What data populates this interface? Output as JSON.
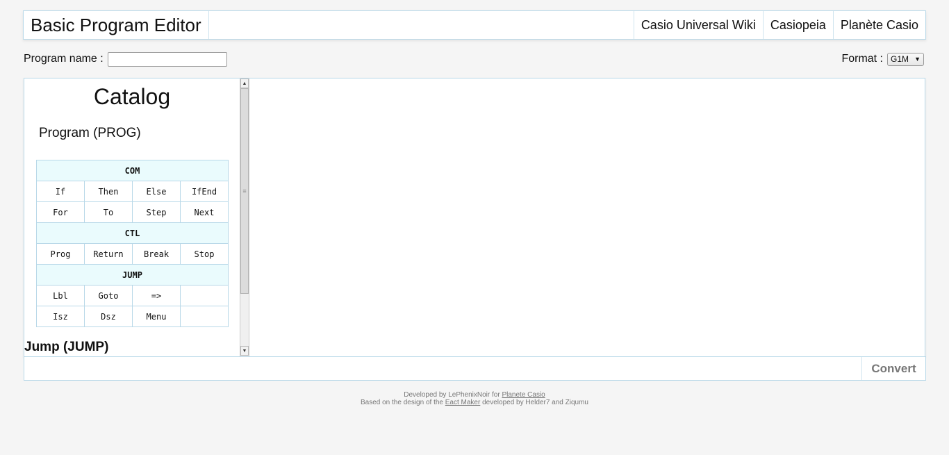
{
  "header": {
    "title": "Basic Program Editor",
    "links": [
      "Casio Universal Wiki",
      "Casiopeia",
      "Planète Casio"
    ]
  },
  "toolbar": {
    "program_name_label": "Program name :",
    "program_name_value": "",
    "format_label": "Format :",
    "format_value": "G1M"
  },
  "catalog": {
    "title": "Catalog",
    "section": "Program (PROG)",
    "groups": [
      {
        "name": "COM",
        "rows": [
          [
            "If",
            "Then",
            "Else",
            "IfEnd"
          ],
          [
            "For",
            "To",
            "Step",
            "Next"
          ]
        ]
      },
      {
        "name": "CTL",
        "rows": [
          [
            "Prog",
            "Return",
            "Break",
            "Stop"
          ]
        ]
      },
      {
        "name": "JUMP",
        "rows": [
          [
            "Lbl",
            "Goto",
            "=>",
            ""
          ],
          [
            "Isz",
            "Dsz",
            "Menu",
            ""
          ]
        ]
      }
    ],
    "next_section": "Jump (JUMP)"
  },
  "actions": {
    "convert_label": "Convert"
  },
  "footer": {
    "line1_prefix": "Developed by LePhenixNoir for",
    "line1_link": "Planete Casio",
    "line2_prefix": "Based on the design of the",
    "line2_link": "Eact Maker",
    "line2_suffix": "developed by Helder7 and Ziqumu"
  },
  "colors": {
    "border": "#b8d8e8",
    "table_header_bg": "#eafbfd",
    "page_bg": "#f5f5f5"
  }
}
